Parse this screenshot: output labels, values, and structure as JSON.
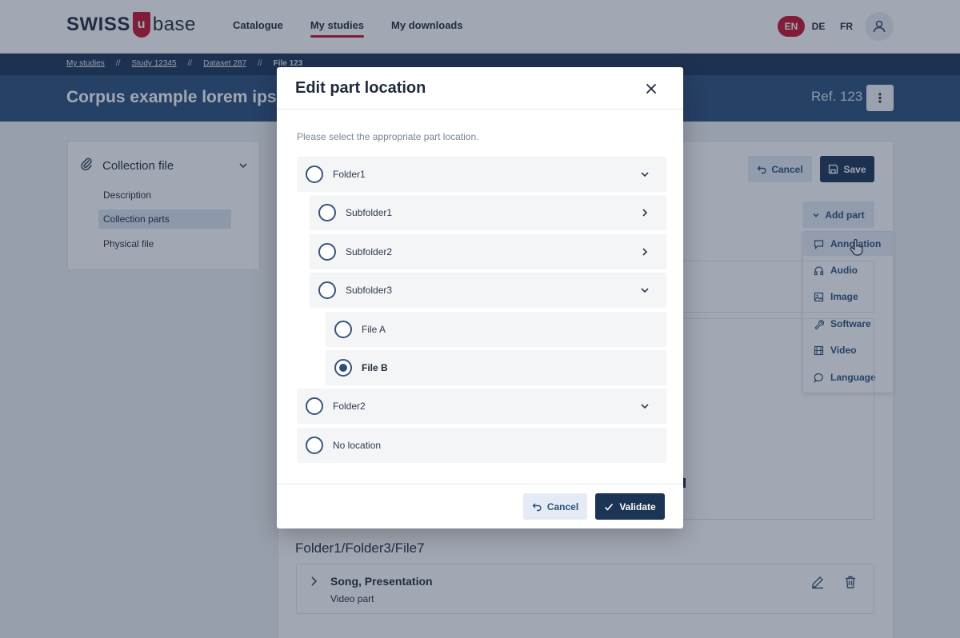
{
  "header": {
    "logo_left": "SWISS",
    "logo_mark": "u",
    "logo_right": "base",
    "nav": [
      "Catalogue",
      "My studies",
      "My downloads"
    ],
    "active_nav": "My studies",
    "languages": [
      "EN",
      "DE",
      "FR"
    ],
    "active_language": "EN"
  },
  "breadcrumb": {
    "items": [
      "My studies",
      "Study 12345",
      "Dataset 287",
      "File 123"
    ],
    "separator": "//"
  },
  "page": {
    "title": "Corpus example lorem ipsum",
    "ref": "Ref. 123"
  },
  "sidebar": {
    "title": "Collection file",
    "items": [
      "Description",
      "Collection parts",
      "Physical file"
    ],
    "active_item": "Collection parts"
  },
  "content": {
    "cancel_label": "Cancel",
    "save_label": "Save",
    "add_part_label": "Add part",
    "add_part_menu": [
      "Annotation",
      "Audio",
      "Image",
      "Software",
      "Video",
      "Language"
    ],
    "path": "Folder1/Folder3/File7",
    "part": {
      "title": "Song, Presentation",
      "subtitle": "Video part"
    }
  },
  "modal": {
    "title": "Edit part location",
    "description": "Please select the appropriate part location.",
    "options": [
      {
        "label": "Folder1",
        "level": 0,
        "chevron": "down",
        "checked": false
      },
      {
        "label": "Subfolder1",
        "level": 1,
        "chevron": "right",
        "checked": false
      },
      {
        "label": "Subfolder2",
        "level": 1,
        "chevron": "right",
        "checked": false
      },
      {
        "label": "Subfolder3",
        "level": 1,
        "chevron": "down",
        "checked": false
      },
      {
        "label": "File A",
        "level": 2,
        "chevron": "none",
        "checked": false
      },
      {
        "label": "File B",
        "level": 2,
        "chevron": "none",
        "checked": true
      },
      {
        "label": "Folder2",
        "level": 0,
        "chevron": "down",
        "checked": false
      },
      {
        "label": "No location",
        "level": 0,
        "chevron": "none",
        "checked": false
      }
    ],
    "cancel_label": "Cancel",
    "validate_label": "Validate"
  },
  "colors": {
    "brand_red": "#c8102e",
    "navy": "#1c3456",
    "title_bar": "#2b4f7a"
  }
}
